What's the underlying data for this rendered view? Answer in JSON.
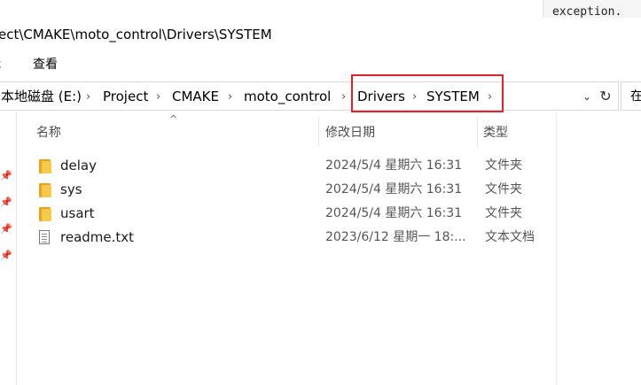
{
  "background_window": {
    "code_text": "exception."
  },
  "window": {
    "title": "ect\\CMAKE\\moto_control\\Drivers\\SYSTEM"
  },
  "ribbon": {
    "tabs": [
      "ɛ",
      "查看"
    ]
  },
  "address_bar": {
    "breadcrumbs": [
      "本地磁盘 (E:)",
      "Project",
      "CMAKE",
      "moto_control",
      "Drivers",
      "SYSTEM"
    ],
    "search_placeholder": "在"
  },
  "columns": {
    "name": "名称",
    "date": "修改日期",
    "type": "类型"
  },
  "files": [
    {
      "name": "delay",
      "date": "2024/5/4 星期六 16:31",
      "type": "文件夹",
      "icon": "folder-icon"
    },
    {
      "name": "sys",
      "date": "2024/5/4 星期六 16:31",
      "type": "文件夹",
      "icon": "folder-icon"
    },
    {
      "name": "usart",
      "date": "2024/5/4 星期六 16:31",
      "type": "文件夹",
      "icon": "folder-icon"
    },
    {
      "name": "readme.txt",
      "date": "2023/6/12 星期一 18:...",
      "type": "文本文档",
      "icon": "text-file-icon"
    }
  ],
  "colors": {
    "highlight": "#e0202a",
    "folder": "#f8c84a"
  }
}
